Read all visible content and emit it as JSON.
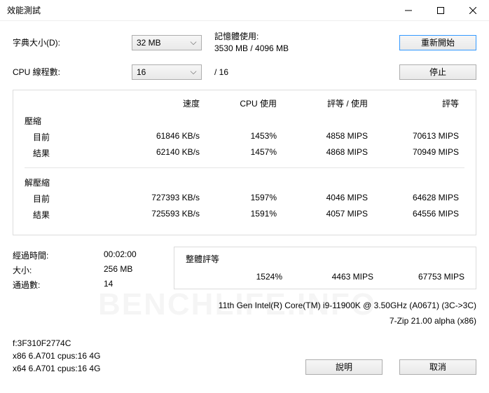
{
  "window": {
    "title": "效能測試"
  },
  "controls": {
    "dict_size_label": "字典大小(D):",
    "dict_size_value": "32 MB",
    "threads_label": "CPU 線程數:",
    "threads_value": "16",
    "threads_total": "/ 16",
    "memory_label": "記憶體使用:",
    "memory_value": "3530 MB / 4096 MB",
    "restart_btn": "重新開始",
    "stop_btn": "停止"
  },
  "headers": {
    "speed": "速度",
    "cpu_usage": "CPU 使用",
    "rating_usage": "評等 / 使用",
    "rating": "評等"
  },
  "compress": {
    "section": "壓縮",
    "current_label": "目前",
    "current": {
      "speed": "61846 KB/s",
      "cpu": "1453%",
      "ru": "4858 MIPS",
      "rating": "70613 MIPS"
    },
    "result_label": "結果",
    "result": {
      "speed": "62140 KB/s",
      "cpu": "1457%",
      "ru": "4868 MIPS",
      "rating": "70949 MIPS"
    }
  },
  "decompress": {
    "section": "解壓縮",
    "current_label": "目前",
    "current": {
      "speed": "727393 KB/s",
      "cpu": "1597%",
      "ru": "4046 MIPS",
      "rating": "64628 MIPS"
    },
    "result_label": "結果",
    "result": {
      "speed": "725593 KB/s",
      "cpu": "1591%",
      "ru": "4057 MIPS",
      "rating": "64556 MIPS"
    }
  },
  "summary": {
    "elapsed_label": "經過時間:",
    "elapsed_value": "00:02:00",
    "size_label": "大小:",
    "size_value": "256 MB",
    "passes_label": "通過數:",
    "passes_value": "14",
    "overall_label": "整體評等",
    "overall": {
      "cpu": "1524%",
      "ru": "4463 MIPS",
      "rating": "67753 MIPS"
    }
  },
  "info": {
    "cpu": "11th Gen Intel(R) Core(TM) i9-11900K @ 3.50GHz (A0671) (3C->3C)",
    "app": "7-Zip 21.00 alpha (x86)",
    "line1": "f:3F310F2774C",
    "line2": "x86 6.A701 cpus:16 4G",
    "line3": "x64 6.A701 cpus:16 4G"
  },
  "buttons": {
    "help": "說明",
    "cancel": "取消"
  },
  "watermark": "BENCHLIFE.INFO"
}
